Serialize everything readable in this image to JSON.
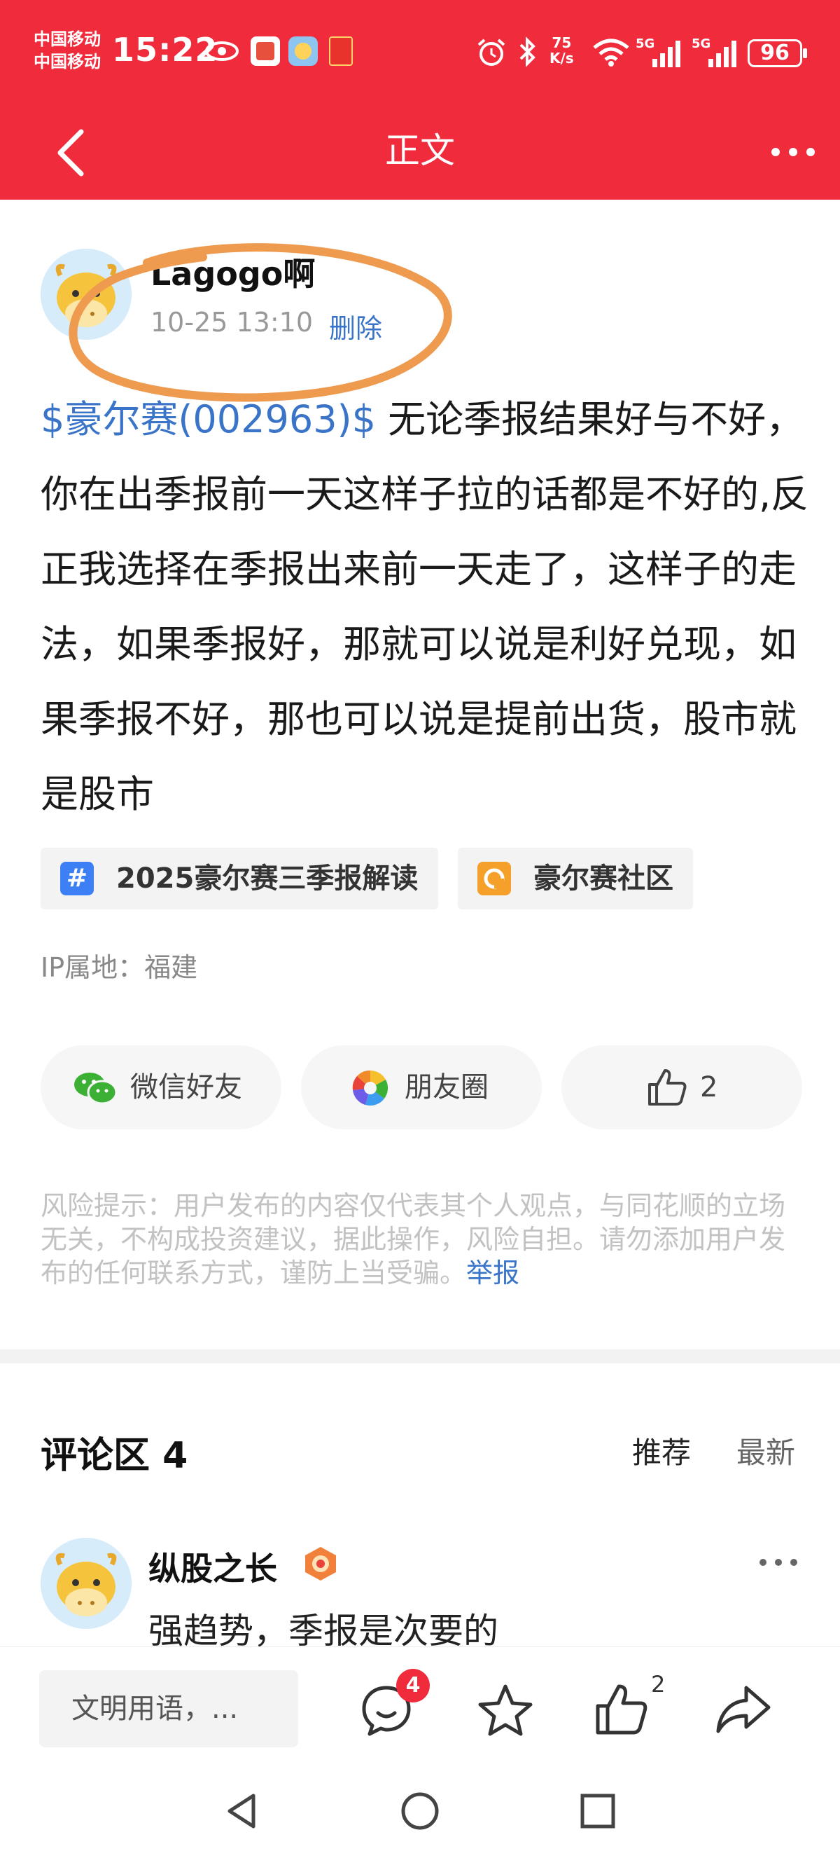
{
  "status_bar": {
    "carrier_1": "中国移动",
    "carrier_2": "中国移动",
    "time": "15:22",
    "net_speed_value": "75",
    "net_speed_unit": "K/s",
    "signal_1": "5G",
    "signal_2": "5G",
    "battery": "96"
  },
  "nav": {
    "title": "正文"
  },
  "post": {
    "author": "Lagogo啊",
    "time": "10-25 13:10",
    "delete_label": "删除",
    "stock_link": "$豪尔赛(002963)$",
    "body": " 无论季报结果好与不好，你在出季报前一天这样子拉的话都是不好的,反正我选择在季报出来前一天走了，这样子的走法，如果季报好，那就可以说是利好兑现，如果季报不好，那也可以说是提前出货，股市就是股市",
    "tags": [
      {
        "label": "2025豪尔赛三季报解读",
        "icon": "#"
      },
      {
        "label": "豪尔赛社区",
        "icon": "community-icon"
      }
    ],
    "ip_location": "IP属地：福建"
  },
  "share": {
    "wechat_label": "微信好友",
    "moments_label": "朋友圈",
    "like_count": "2"
  },
  "risk": {
    "text": "风险提示：用户发布的内容仅代表其个人观点，与同花顺的立场无关，不构成投资建议，据此操作，风险自担。请勿添加用户发布的任何联系方式，谨防上当受骗。",
    "report_label": "举报"
  },
  "comments": {
    "title": "评论区 4",
    "sort_recommend": "推荐",
    "sort_latest": "最新",
    "items": [
      {
        "author": "纵股之长",
        "text": "强趋势，季报是次要的"
      }
    ]
  },
  "bottom_bar": {
    "input_placeholder": "文明用语，...",
    "comment_count": "4",
    "like_count": "2"
  },
  "colors": {
    "brand_red": "#ef2b3c",
    "link_blue": "#3a74c8",
    "annotation_orange": "#ee9a4f"
  }
}
